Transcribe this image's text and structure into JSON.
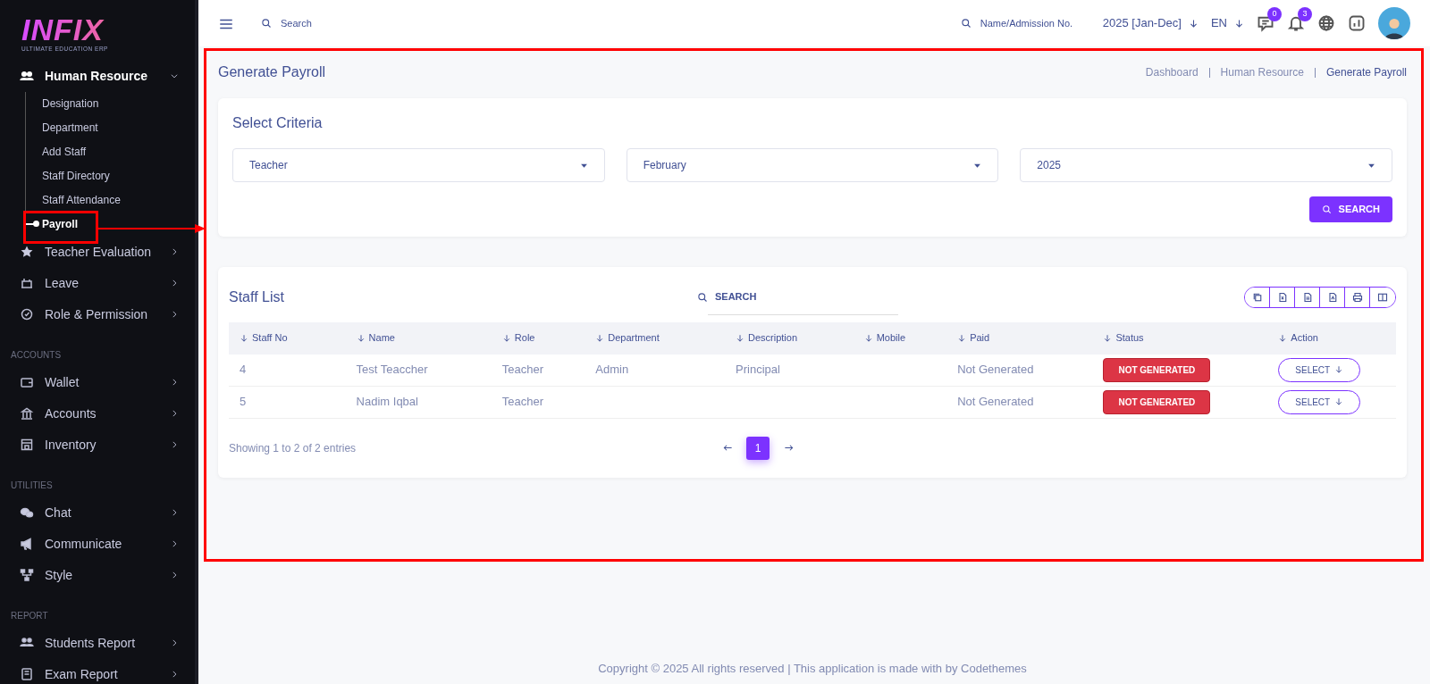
{
  "logo": {
    "text": "INFIX",
    "tagline": "ULTIMATE EDUCATION ERP"
  },
  "sidebar": {
    "sections": [
      {
        "items": [
          {
            "label": "Human Resource",
            "expanded": true,
            "children": [
              {
                "label": "Designation",
                "selected": false
              },
              {
                "label": "Department",
                "selected": false
              },
              {
                "label": "Add Staff",
                "selected": false
              },
              {
                "label": "Staff Directory",
                "selected": false
              },
              {
                "label": "Staff Attendance",
                "selected": false
              },
              {
                "label": "Payroll",
                "selected": true
              }
            ]
          },
          {
            "label": "Teacher Evaluation",
            "expanded": false
          },
          {
            "label": "Leave",
            "expanded": false
          },
          {
            "label": "Role & Permission",
            "expanded": false
          }
        ]
      },
      {
        "heading": "ACCOUNTS",
        "items": [
          {
            "label": "Wallet",
            "expanded": false
          },
          {
            "label": "Accounts",
            "expanded": false
          },
          {
            "label": "Inventory",
            "expanded": false
          }
        ]
      },
      {
        "heading": "UTILITIES",
        "items": [
          {
            "label": "Chat",
            "expanded": false
          },
          {
            "label": "Communicate",
            "expanded": false
          },
          {
            "label": "Style",
            "expanded": false
          }
        ]
      },
      {
        "heading": "REPORT",
        "items": [
          {
            "label": "Students Report",
            "expanded": false
          },
          {
            "label": "Exam Report",
            "expanded": false
          }
        ]
      }
    ]
  },
  "topbar": {
    "search": {
      "placeholder": "Search"
    },
    "student_search": {
      "placeholder": "Name/Admission No."
    },
    "session": "2025 [Jan-Dec]",
    "language": "EN",
    "chat_count": "0",
    "notification_count": "3"
  },
  "page_title": "Generate Payroll",
  "breadcrumbs": [
    "Dashboard",
    "Human Resource",
    "Generate Payroll"
  ],
  "criteria": {
    "title": "Select Criteria",
    "selects": [
      "Teacher",
      "February",
      "2025"
    ],
    "button": "SEARCH"
  },
  "staff_list": {
    "title": "Staff List",
    "search": {
      "placeholder": "SEARCH"
    },
    "columns": [
      "Staff No",
      "Name",
      "Role",
      "Department",
      "Description",
      "Mobile",
      "Paid",
      "Status",
      "Action"
    ],
    "rows": [
      {
        "staff_no": "4",
        "name": "Test Teaccher",
        "role": "Teacher",
        "department": "Admin",
        "description": "Principal",
        "mobile": "",
        "paid": "Not Generated",
        "status": "NOT GENERATED",
        "action": "SELECT"
      },
      {
        "staff_no": "5",
        "name": "Nadim Iqbal",
        "role": "Teacher",
        "department": "",
        "description": "",
        "mobile": "",
        "paid": "Not Generated",
        "status": "NOT GENERATED",
        "action": "SELECT"
      }
    ],
    "summary": "Showing 1 to 2 of 2 entries",
    "pages": [
      {
        "label": "1",
        "selected": true
      }
    ]
  },
  "footer": "Copyright © 2025 All rights reserved | This application is made with by Codethemes"
}
